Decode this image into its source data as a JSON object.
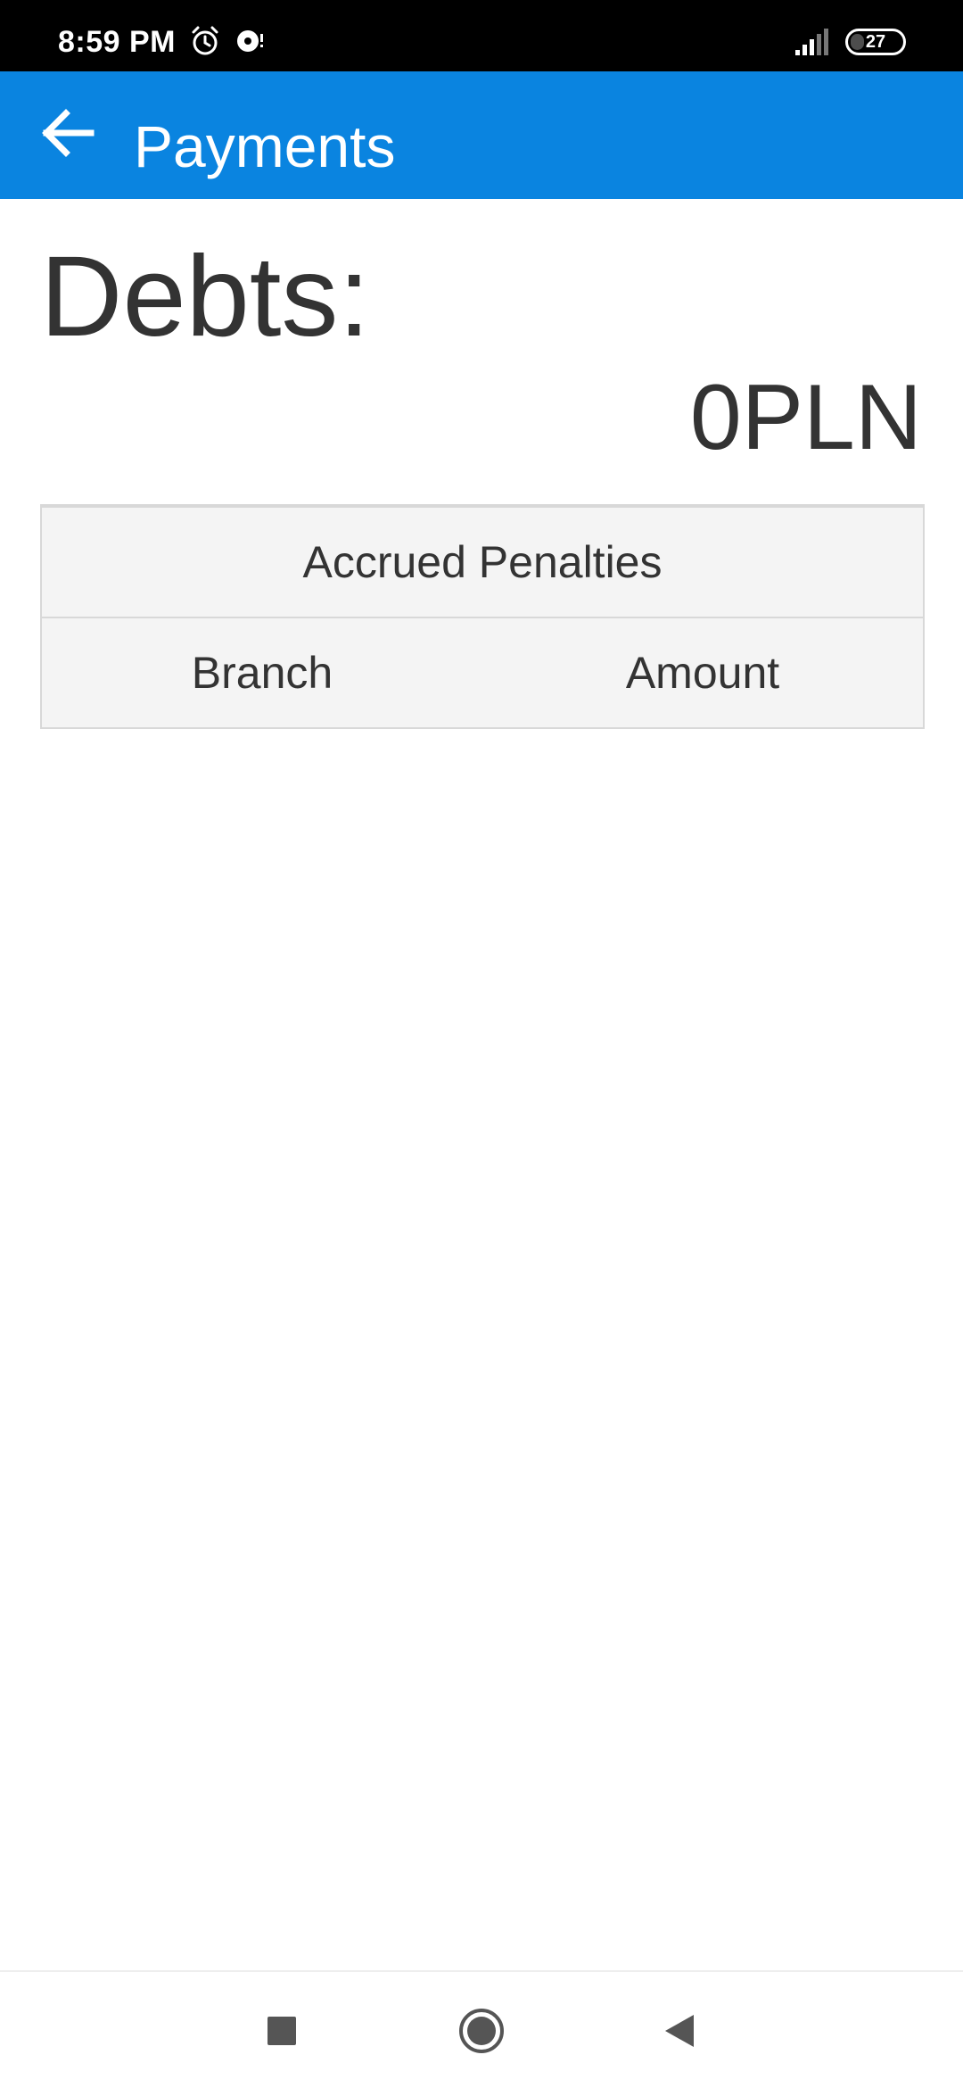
{
  "status_bar": {
    "time": "8:59 PM",
    "battery_level": "27",
    "icons": [
      "alarm-icon",
      "sync-icon",
      "signal-icon",
      "battery-icon"
    ]
  },
  "app_bar": {
    "title": "Payments",
    "back_icon": "arrow-left-icon",
    "color": "#0a84e0"
  },
  "debts": {
    "label": "Debts:",
    "amount": "0PLN"
  },
  "penalties_table": {
    "caption": "Accrued Penalties",
    "columns": [
      "Branch",
      "Amount"
    ],
    "rows": []
  },
  "nav_bar": {
    "icons": [
      "recents-square-icon",
      "home-circle-icon",
      "back-triangle-icon"
    ]
  }
}
